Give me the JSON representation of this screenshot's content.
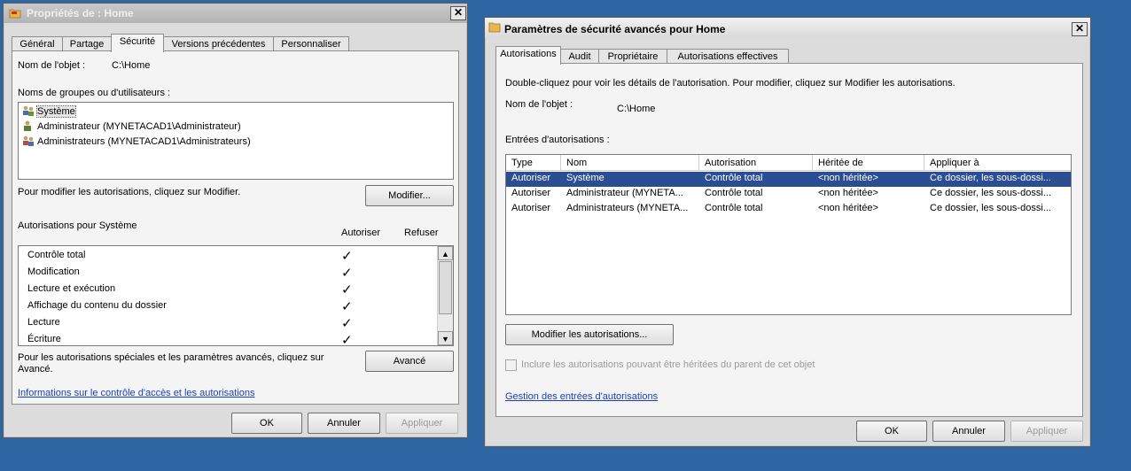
{
  "left_window": {
    "title": "Propriétés de : Home",
    "close": "✕",
    "tabs": [
      "Général",
      "Partage",
      "Sécurité",
      "Versions précédentes",
      "Personnaliser"
    ],
    "object_label": "Nom de l'objet :",
    "object_value": "C:\\Home",
    "groups_label": "Noms de groupes ou d'utilisateurs :",
    "users": [
      "Système",
      "Administrateur (MYNETACAD1\\Administrateur)",
      "Administrateurs (MYNETACAD1\\Administrateurs)"
    ],
    "modify_hint": "Pour modifier les autorisations, cliquez sur Modifier.",
    "modify_button": "Modifier...",
    "perms_label": "Autorisations pour Système",
    "allow_header": "Autoriser",
    "deny_header": "Refuser",
    "permissions": [
      {
        "name": "Contrôle total",
        "allow": "✓"
      },
      {
        "name": "Modification",
        "allow": "✓"
      },
      {
        "name": "Lecture et exécution",
        "allow": "✓"
      },
      {
        "name": "Affichage du contenu du dossier",
        "allow": "✓"
      },
      {
        "name": "Lecture",
        "allow": "✓"
      },
      {
        "name": "Écriture",
        "allow": "✓"
      }
    ],
    "advanced_hint_1": "Pour les autorisations spéciales et les paramètres avancés, cliquez sur",
    "advanced_hint_2": "Avancé.",
    "advanced_button": "Avancé",
    "info_link": "Informations sur le contrôle d'accès et les autorisations",
    "ok": "OK",
    "cancel": "Annuler",
    "apply": "Appliquer"
  },
  "right_window": {
    "title": "Paramètres de sécurité avancés pour Home",
    "close": "✕",
    "tabs": [
      "Autorisations",
      "Audit",
      "Propriétaire",
      "Autorisations effectives"
    ],
    "instruction": "Double-cliquez pour voir les détails de l'autorisation. Pour modifier, cliquez sur Modifier les autorisations.",
    "object_label": "Nom de l'objet :",
    "object_value": "C:\\Home",
    "entries_label": "Entrées d'autorisations :",
    "columns": [
      "Type",
      "Nom",
      "Autorisation",
      "Héritée de",
      "Appliquer à"
    ],
    "rows": [
      [
        "Autoriser",
        "Système",
        "Contrôle total",
        "<non héritée>",
        "Ce dossier, les sous-dossi..."
      ],
      [
        "Autoriser",
        "Administrateur (MYNETA...",
        "Contrôle total",
        "<non héritée>",
        "Ce dossier, les sous-dossi..."
      ],
      [
        "Autoriser",
        "Administrateurs (MYNETA...",
        "Contrôle total",
        "<non héritée>",
        "Ce dossier, les sous-dossi..."
      ]
    ],
    "modify_button": "Modifier les autorisations...",
    "inherit_checkbox": "Inclure les autorisations pouvant être héritées du parent de cet objet",
    "manage_link": "Gestion des entrées d'autorisations",
    "ok": "OK",
    "cancel": "Annuler",
    "apply": "Appliquer"
  },
  "colors": {
    "desktop": "#2e65a3",
    "selection": "#2a4d94",
    "link": "#1a3fc2"
  }
}
